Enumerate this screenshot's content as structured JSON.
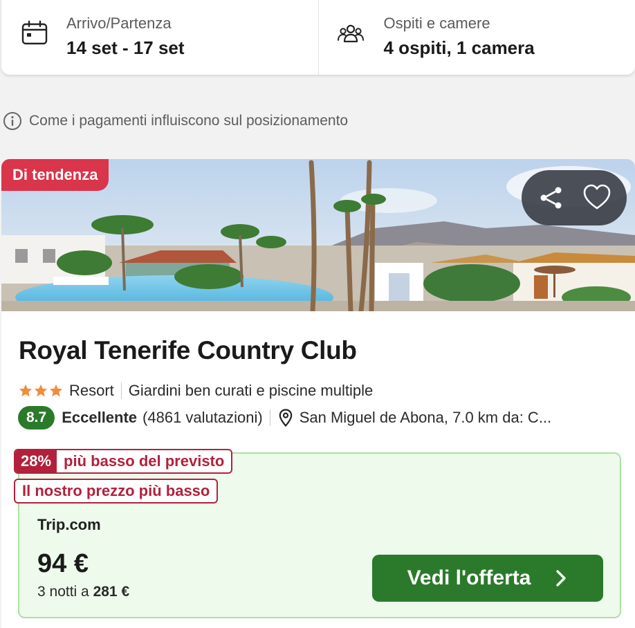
{
  "search": {
    "dates_label": "Arrivo/Partenza",
    "dates_value": "14 set - 17 set",
    "guests_label": "Ospiti e camere",
    "guests_value": "4 ospiti, 1 camera"
  },
  "disclosure": "Come i pagamenti influiscono sul posizionamento",
  "hotel": {
    "badge": "Di tendenza",
    "name": "Royal Tenerife Country Club",
    "stars": 3,
    "type": "Resort",
    "highlight": "Giardini ben curati e piscine multiple",
    "score": "8.7",
    "score_word": "Eccellente",
    "reviews": "(4861 valutazioni)",
    "location": "San Miguel de Abona, 7.0 km da: C..."
  },
  "offer": {
    "deal_pct": "28%",
    "deal_text": "più basso del previsto",
    "lowest_tag": "Il nostro prezzo più basso",
    "provider": "Trip.com",
    "price": "94 €",
    "total_prefix": "3 notti a",
    "total_amount": "281 €",
    "cta": "Vedi l'offerta"
  },
  "colors": {
    "accent_green": "#2b7a2b",
    "badge_red": "#d9354b",
    "deal_red": "#b2213c",
    "star_orange": "#f08c3a"
  }
}
